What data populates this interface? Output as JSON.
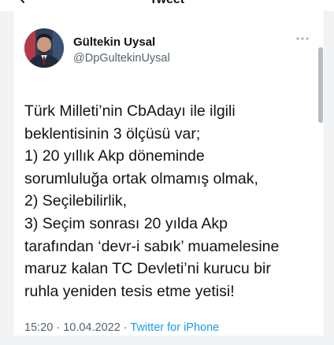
{
  "header": {
    "title": "Tweet"
  },
  "tweet": {
    "author_name": "Gültekin Uysal",
    "author_handle": "@DpGultekinUysal",
    "text": "Türk Milleti’nin CbAdayı ile ilgili\nbeklentisinin 3 ölçüsü var;\n1) 20 yıllık Akp döneminde\nsorumluluğa ortak olmamış olmak,\n2) Seçilebilirlik,\n3) Seçim sonrası 20 yılda Akp\ntarafından ‘devr-i sabık’ muamelesine\nmaruz kalan TC Devleti’ni kurucu bir\nruhla yeniden tesis etme yetisi!",
    "time": "15:20",
    "separator": " · ",
    "date": "10.04.2022",
    "source": "Twitter for iPhone"
  },
  "icons": {
    "back": "arrow-left-icon",
    "more": "more-horizontal-icon"
  },
  "colors": {
    "text_primary": "#0f1419",
    "text_secondary": "#536471",
    "link": "#1d9bf0",
    "background": "#f2f3f4",
    "card": "#ffffff"
  }
}
